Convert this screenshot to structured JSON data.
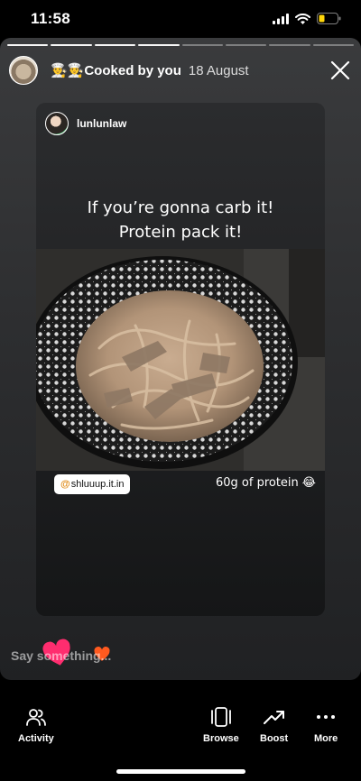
{
  "status": {
    "time": "11:58"
  },
  "story": {
    "progress_total": 8,
    "progress_done": 4,
    "header": {
      "title": "👨‍🍳👨‍🍳Cooked by you",
      "date": "18 August"
    },
    "card": {
      "username": "lunlunlaw",
      "caption_line1": "If you’re gonna carb it!",
      "caption_line2": "Protein pack it!",
      "mention_at": "@",
      "mention_handle": "shluuup.it.in",
      "protein_text": "60g of protein",
      "protein_emoji": "😂"
    },
    "reply_placeholder": "Say something..."
  },
  "nav": {
    "activity": "Activity",
    "browse": "Browse",
    "boost": "Boost",
    "more": "More"
  },
  "colors": {
    "heart_pink": "#ff2d6f",
    "heart_orange": "#ff5a1f",
    "mention_at": "#e08c1a"
  },
  "icons": [
    "signal-icon",
    "wifi-icon",
    "battery-icon",
    "close-icon",
    "heart-icon",
    "people-icon",
    "browse-icon",
    "trend-up-icon",
    "more-dots-icon"
  ]
}
